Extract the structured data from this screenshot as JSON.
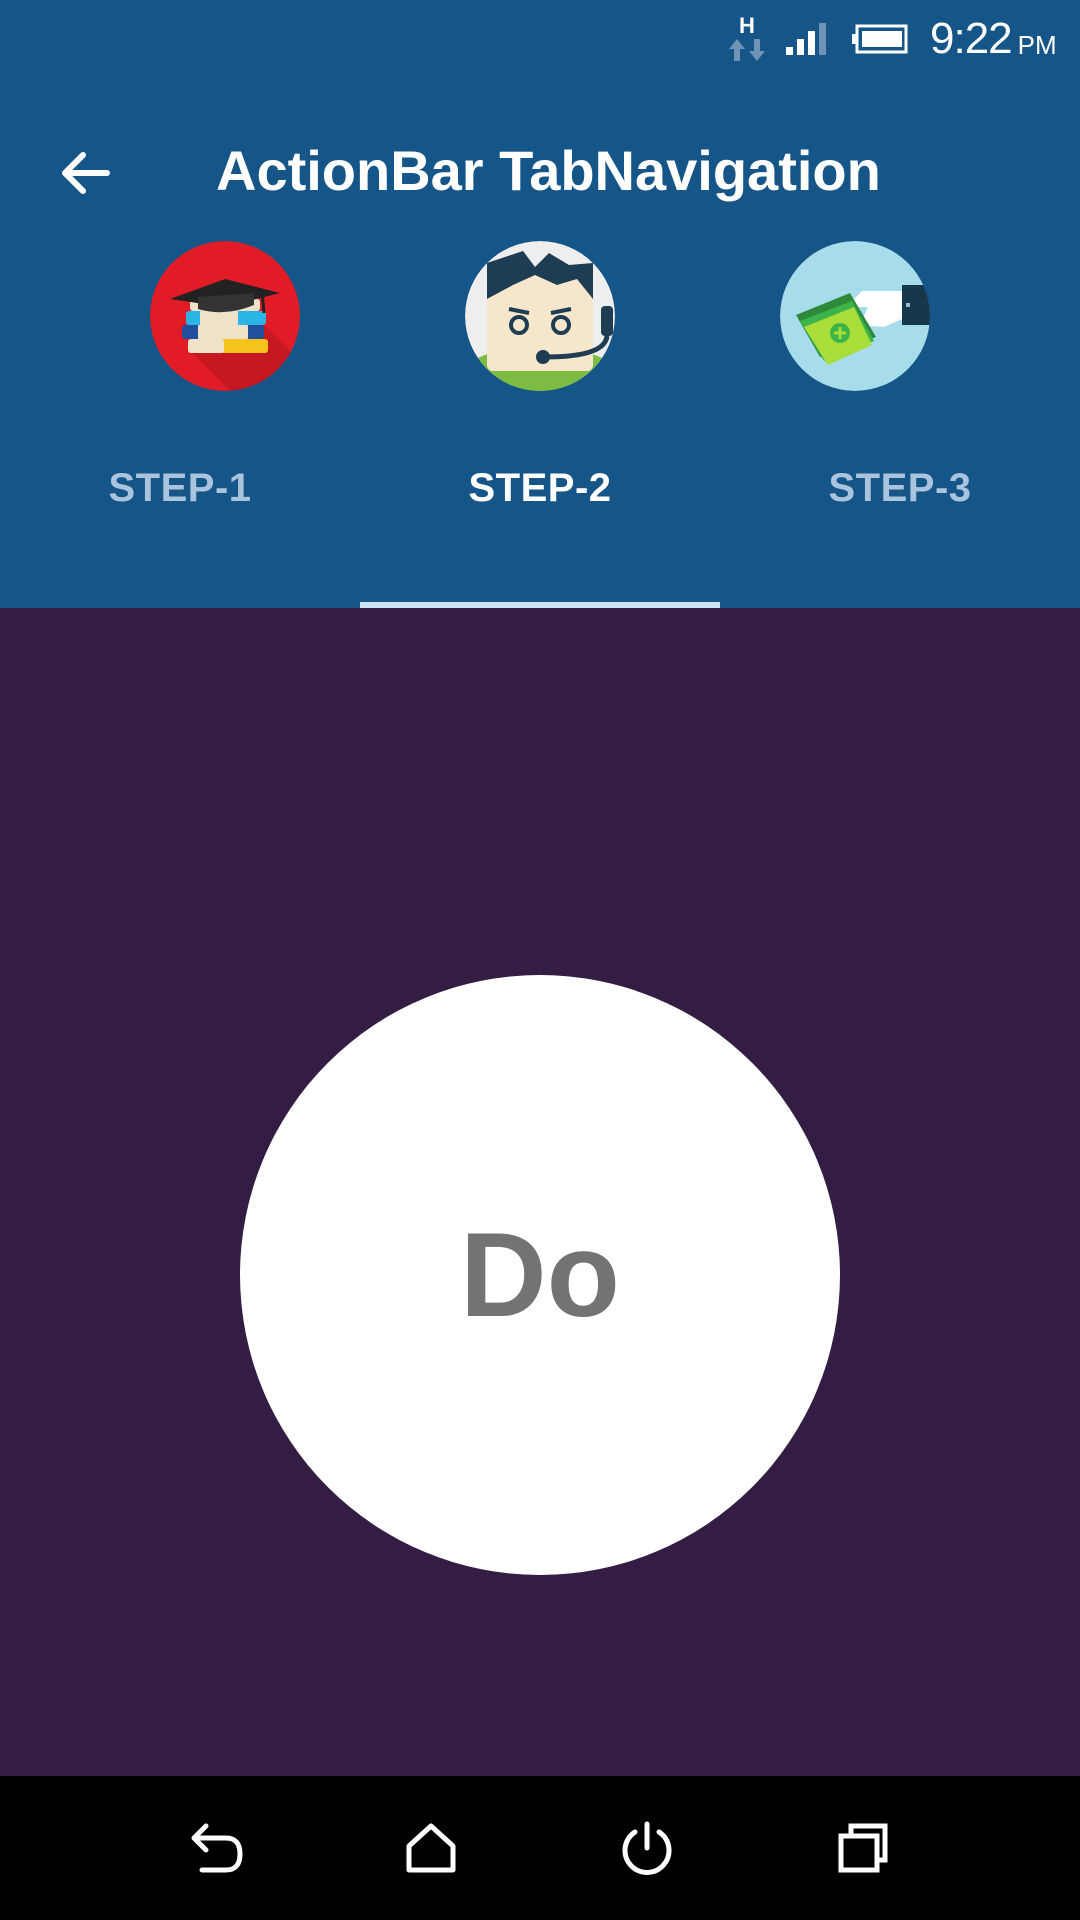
{
  "status_bar": {
    "network_type": "H",
    "time": "9:22",
    "ampm": "PM",
    "icons": [
      "network-type-icon",
      "signal-icon",
      "battery-icon"
    ]
  },
  "app_bar": {
    "title": "ActionBar TabNavigation",
    "back_icon": "arrow-back-icon",
    "background_color": "#155588"
  },
  "tabs": [
    {
      "label": "STEP-1",
      "icon": "books-graduation-icon",
      "selected": false
    },
    {
      "label": "STEP-2",
      "icon": "support-agent-icon",
      "selected": true
    },
    {
      "label": "STEP-3",
      "icon": "money-handover-icon",
      "selected": false
    }
  ],
  "content": {
    "background_color": "#341d43",
    "button_label": "Do"
  },
  "nav_bar": {
    "icons": [
      "back-icon",
      "home-icon",
      "power-icon",
      "recent-apps-icon"
    ]
  }
}
